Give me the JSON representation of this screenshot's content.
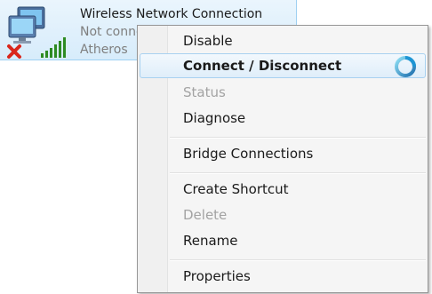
{
  "connection": {
    "name": "Wireless Network Connection",
    "status": "Not connected",
    "adapter": "Atheros",
    "icon": "wireless-network-icon",
    "status_icon": "red-x-icon",
    "signal_icon": "signal-bars-icon"
  },
  "context_menu": {
    "items": [
      {
        "label": "Disable",
        "state": "enabled"
      },
      {
        "label": "Connect / Disconnect",
        "state": "default-highlighted"
      },
      {
        "label": "Status",
        "state": "disabled"
      },
      {
        "label": "Diagnose",
        "state": "enabled"
      },
      {
        "label": "Bridge Connections",
        "state": "enabled"
      },
      {
        "label": "Create Shortcut",
        "state": "enabled"
      },
      {
        "label": "Delete",
        "state": "disabled"
      },
      {
        "label": "Rename",
        "state": "enabled"
      },
      {
        "label": "Properties",
        "state": "enabled"
      }
    ],
    "busy_icon": "loading-spinner-icon"
  },
  "colors": {
    "accent": "#1e95d4",
    "highlight_border": "#a8d1f0",
    "error_red": "#d9261c",
    "signal_green": "#2e8b22"
  }
}
